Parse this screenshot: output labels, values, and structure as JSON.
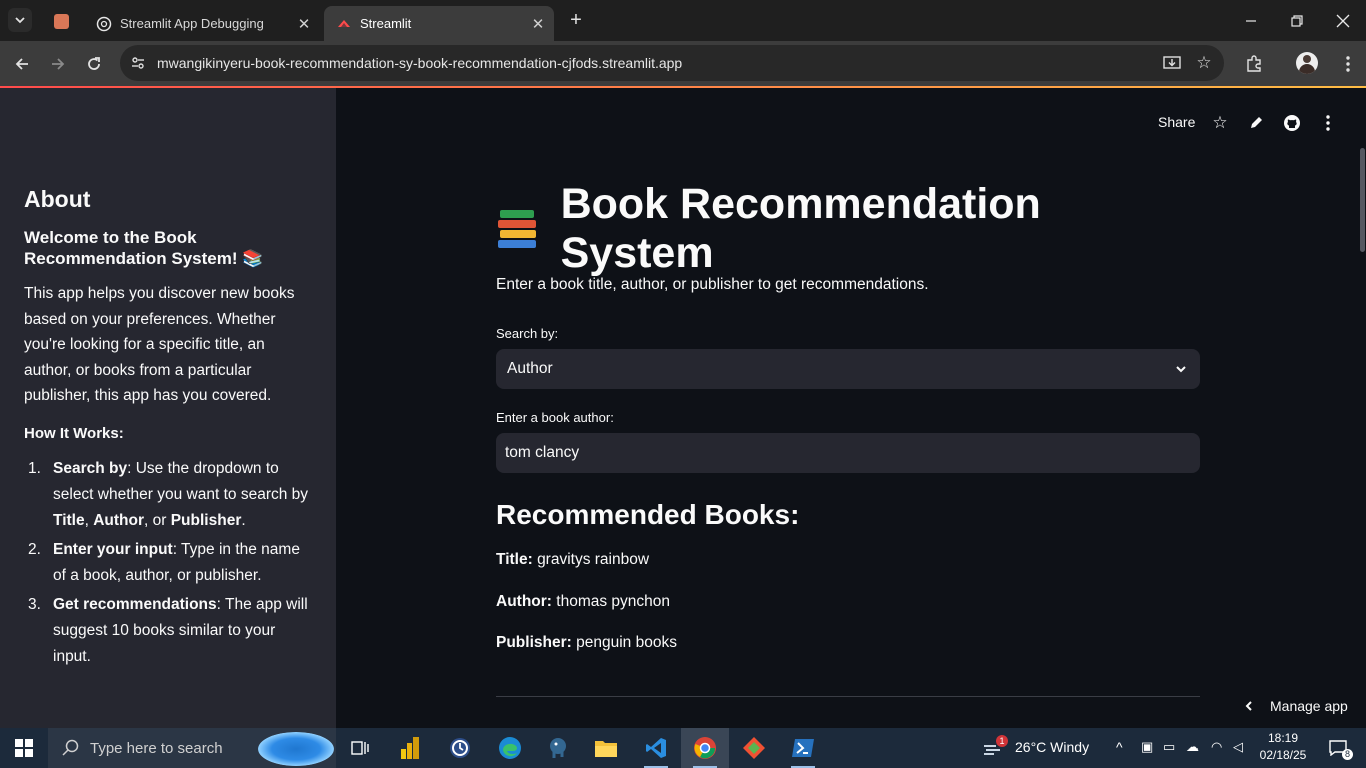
{
  "browser": {
    "tabs": [
      {
        "title": "Streamlit App Debugging",
        "icon": "chatgpt-icon"
      },
      {
        "title": "Streamlit",
        "icon": "streamlit-crown-icon",
        "active": true
      }
    ],
    "url": "mwangikinyeru-book-recommendation-sy-book-recommendation-cjfods.streamlit.app"
  },
  "header": {
    "share_label": "Share"
  },
  "sidebar": {
    "title": "About",
    "welcome": "Welcome to the Book Recommendation System! 📚",
    "description": "This app helps you discover new books based on your preferences. Whether you're looking for a specific title, an author, or books from a particular publisher, this app has you covered.",
    "how_it_works": "How It Works:",
    "steps": [
      {
        "num": "1.",
        "bold": "Search by",
        "text": ": Use the dropdown to select whether you want to search by ",
        "b1": "Title",
        "t1": ", ",
        "b2": "Author",
        "t2": ", or ",
        "b3": "Publisher",
        "t3": "."
      },
      {
        "num": "2.",
        "bold": "Enter your input",
        "text": ": Type in the name of a book, author, or publisher."
      },
      {
        "num": "3.",
        "bold": "Get recommendations",
        "text": ": The app will suggest 10 books similar to your input."
      }
    ]
  },
  "main": {
    "title": "Book Recommendation System",
    "intro": "Enter a book title, author, or publisher to get recommendations.",
    "search_by_label": "Search by:",
    "search_by_value": "Author",
    "input_label": "Enter a book author:",
    "input_value": "tom clancy",
    "results_heading": "Recommended Books:",
    "result": {
      "title_label": "Title:",
      "title_value": "gravitys rainbow",
      "author_label": "Author:",
      "author_value": "thomas pynchon",
      "publisher_label": "Publisher:",
      "publisher_value": "penguin books"
    },
    "manage_app": "Manage app"
  },
  "taskbar": {
    "search_placeholder": "Type here to search",
    "weather": "26°C  Windy",
    "weather_badge": "1",
    "time": "18:19",
    "date": "02/18/25",
    "notification_count": "8"
  },
  "colors": {
    "sidebar_bg": "#262730",
    "main_bg": "#0e1117",
    "accent_gradient": [
      "#ff4b4b",
      "#ffbd45"
    ]
  }
}
